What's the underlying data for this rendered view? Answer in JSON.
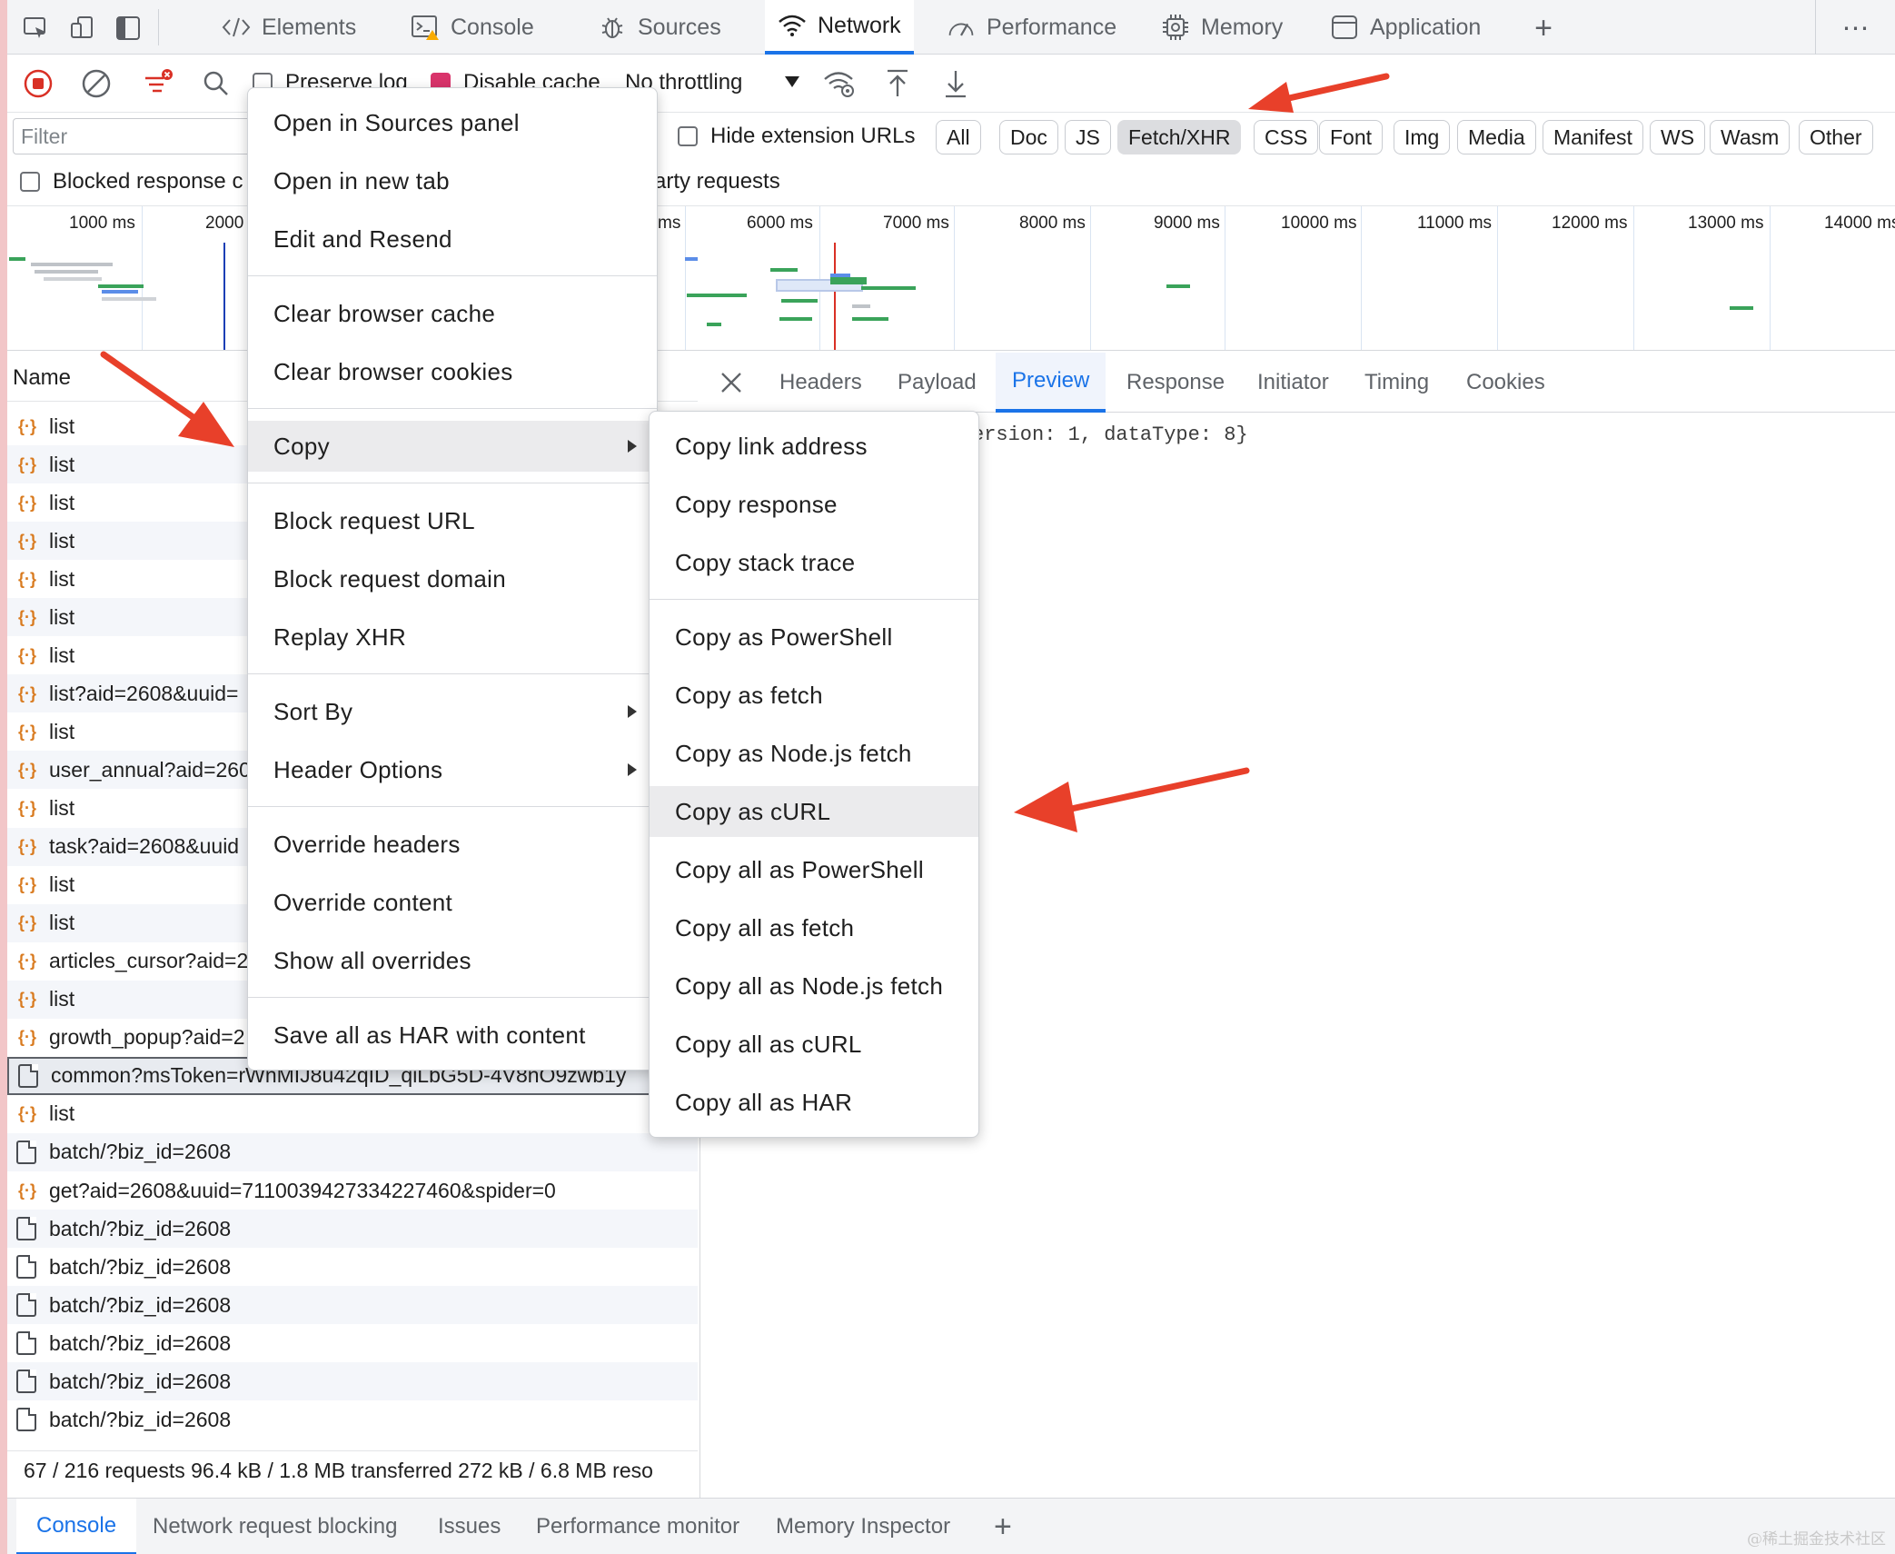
{
  "panel_tabs": [
    {
      "label": "Elements",
      "icon": "code-brackets-icon"
    },
    {
      "label": "Console",
      "icon": "terminal-icon"
    },
    {
      "label": "Sources",
      "icon": "bug-icon"
    },
    {
      "label": "Network",
      "icon": "wifi-icon"
    },
    {
      "label": "Performance",
      "icon": "gauge-icon"
    },
    {
      "label": "Memory",
      "icon": "chip-icon"
    },
    {
      "label": "Application",
      "icon": "window-icon"
    }
  ],
  "active_panel": "Network",
  "toolbar": {
    "preserve_log": "Preserve log",
    "preserve_log_checked": false,
    "disable_cache": "Disable cache",
    "disable_cache_checked": true,
    "throttling": "No throttling"
  },
  "filter": {
    "placeholder": "Filter",
    "hide_extension_urls": "Hide extension URLs",
    "blocked_response": "Blocked response c",
    "third_party": "arty requests",
    "types": [
      "All",
      "Doc",
      "JS",
      "Fetch/XHR",
      "CSS",
      "Font",
      "Img",
      "Media",
      "Manifest",
      "WS",
      "Wasm",
      "Other"
    ],
    "selected_type": "Fetch/XHR"
  },
  "timeline_ticks": [
    "1000 ms",
    "2000",
    "ms",
    "6000 ms",
    "7000 ms",
    "8000 ms",
    "9000 ms",
    "10000 ms",
    "11000 ms",
    "12000 ms",
    "13000 ms",
    "14000 ms"
  ],
  "request_list": {
    "column_name": "Name",
    "rows": [
      {
        "name": "list",
        "kind": "xhr"
      },
      {
        "name": "list",
        "kind": "xhr"
      },
      {
        "name": "list",
        "kind": "xhr"
      },
      {
        "name": "list",
        "kind": "xhr"
      },
      {
        "name": "list",
        "kind": "xhr"
      },
      {
        "name": "list",
        "kind": "xhr"
      },
      {
        "name": "list",
        "kind": "xhr"
      },
      {
        "name": "list?aid=2608&uuid=",
        "kind": "xhr"
      },
      {
        "name": "list",
        "kind": "xhr"
      },
      {
        "name": "user_annual?aid=260",
        "kind": "xhr"
      },
      {
        "name": "list",
        "kind": "xhr"
      },
      {
        "name": "task?aid=2608&uuid",
        "kind": "xhr"
      },
      {
        "name": "list",
        "kind": "xhr"
      },
      {
        "name": "list",
        "kind": "xhr"
      },
      {
        "name": "articles_cursor?aid=2",
        "kind": "xhr"
      },
      {
        "name": "list",
        "kind": "xhr"
      },
      {
        "name": "growth_popup?aid=2",
        "kind": "xhr"
      },
      {
        "name": "common?msToken=rWnMIJ8u42qID_qiLbG5D-4V8nO9zwb1y",
        "kind": "doc",
        "selected": true
      },
      {
        "name": "list",
        "kind": "xhr"
      },
      {
        "name": "batch/?biz_id=2608",
        "kind": "doc"
      },
      {
        "name": "get?aid=2608&uuid=7110039427334227460&spider=0",
        "kind": "xhr"
      },
      {
        "name": "batch/?biz_id=2608",
        "kind": "doc"
      },
      {
        "name": "batch/?biz_id=2608",
        "kind": "doc"
      },
      {
        "name": "batch/?biz_id=2608",
        "kind": "doc"
      },
      {
        "name": "batch/?biz_id=2608",
        "kind": "doc"
      },
      {
        "name": "batch/?biz_id=2608",
        "kind": "doc"
      },
      {
        "name": "batch/?biz_id=2608",
        "kind": "doc"
      }
    ]
  },
  "status": "67 / 216 requests  96.4 kB / 1.8 MB transferred  272 kB / 6.8 MB reso",
  "detail": {
    "tabs": [
      "Headers",
      "Payload",
      "Preview",
      "Response",
      "Initiator",
      "Timing",
      "Cookies"
    ],
    "active_tab": "Preview",
    "preview_text": "ersion: 1, dataType: 8}"
  },
  "context_menu": {
    "items": [
      "Open in Sources panel",
      "Open in new tab",
      "Edit and Resend",
      "Clear browser cache",
      "Clear browser cookies",
      "Copy",
      "Block request URL",
      "Block request domain",
      "Replay XHR",
      "Sort By",
      "Header Options",
      "Override headers",
      "Override content",
      "Show all overrides",
      "Save all as HAR with content"
    ],
    "highlighted": "Copy"
  },
  "copy_submenu": {
    "items": [
      "Copy link address",
      "Copy response",
      "Copy stack trace",
      "Copy as PowerShell",
      "Copy as fetch",
      "Copy as Node.js fetch",
      "Copy as cURL",
      "Copy all as PowerShell",
      "Copy all as fetch",
      "Copy all as Node.js fetch",
      "Copy all as cURL",
      "Copy all as HAR"
    ],
    "highlighted": "Copy as cURL"
  },
  "drawer_tabs": [
    "Console",
    "Network request blocking",
    "Issues",
    "Performance monitor",
    "Memory Inspector"
  ],
  "active_drawer_tab": "Console",
  "watermark": "@稀土掘金技术社区",
  "colors": {
    "accent": "#1a73e8",
    "annotation_arrow": "#e8402a",
    "record": "#d93025"
  }
}
